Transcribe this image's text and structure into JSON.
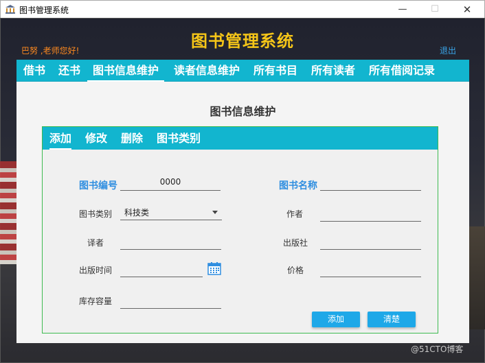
{
  "window": {
    "title": "图书管理系统",
    "minimize": "—",
    "maximize": "☐",
    "close": "✕"
  },
  "header": {
    "system_title": "图书管理系统",
    "greeting": "巴努 ,老师您好!",
    "logout": "退出"
  },
  "nav": {
    "items": [
      {
        "label": "借书"
      },
      {
        "label": "还书"
      },
      {
        "label": "图书信息维护"
      },
      {
        "label": "读者信息维护"
      },
      {
        "label": "所有书目"
      },
      {
        "label": "所有读者"
      },
      {
        "label": "所有借阅记录"
      }
    ],
    "active": "图书信息维护"
  },
  "page": {
    "heading": "图书信息维护",
    "tabs": [
      {
        "label": "添加"
      },
      {
        "label": "修改"
      },
      {
        "label": "删除"
      },
      {
        "label": "图书类别"
      }
    ],
    "active_tab": "添加"
  },
  "form": {
    "book_id_label": "图书编号",
    "book_id_value": "0000",
    "book_name_label": "图书名称",
    "book_name_value": "",
    "category_label": "图书类别",
    "category_value": "科技类",
    "author_label": "作者",
    "author_value": "",
    "translator_label": "译者",
    "translator_value": "",
    "publisher_label": "出版社",
    "publisher_value": "",
    "pubdate_label": "出版时间",
    "pubdate_value": "",
    "price_label": "价格",
    "price_value": "",
    "stock_label": "库存容量",
    "stock_value": "",
    "add_button": "添加",
    "clear_button": "清楚"
  },
  "watermark": "@51CTO博客",
  "colors": {
    "accent": "#12b5cf",
    "title_yellow": "#f5c518",
    "greeting_orange": "#ff8a1f",
    "button_blue": "#1ea8e8",
    "label_blue": "#2f8ee0"
  }
}
